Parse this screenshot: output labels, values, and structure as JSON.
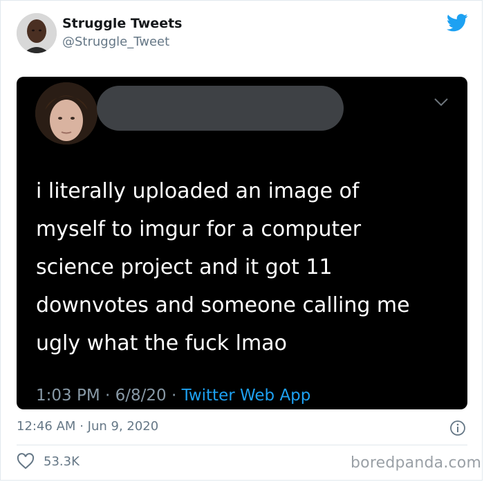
{
  "header": {
    "display_name": "Struggle Tweets",
    "handle": "@Struggle_Tweet",
    "brand_icon": "twitter-bird-icon",
    "brand_color": "#1da1f2"
  },
  "embedded_tweet": {
    "text_lines": [
      "i literally uploaded an image of",
      "myself to imgur for a computer",
      "science project and it got 11",
      "downvotes and someone calling me",
      "ugly what the fuck lmao"
    ],
    "time": "1:03 PM",
    "date": "6/8/20",
    "separator": "·",
    "source": "Twitter Web App",
    "menu_icon": "chevron-down-icon",
    "background_color": "#000000"
  },
  "footer": {
    "time": "12:46 AM",
    "separator": "·",
    "date": "Jun 9, 2020",
    "likes": "53.3K",
    "info_icon": "info-icon",
    "like_icon": "heart-icon"
  },
  "watermark": "boredpanda.com"
}
